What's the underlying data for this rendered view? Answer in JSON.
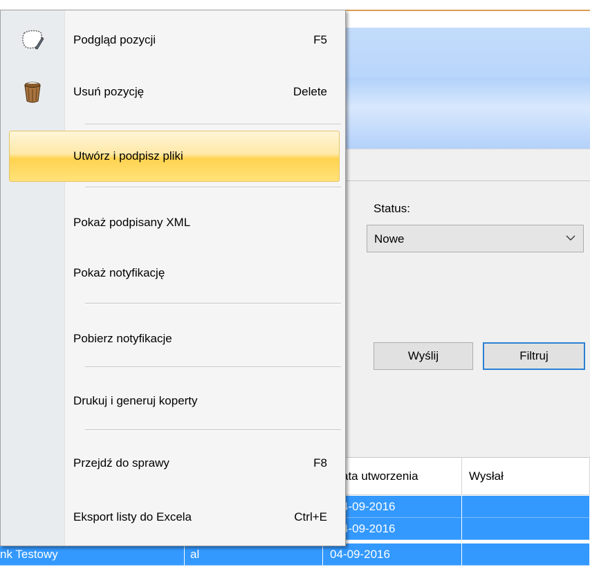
{
  "background": {
    "status_label": "Status:",
    "status_value": "Nowe",
    "send_button": "Wyślij",
    "filter_button": "Filtruj"
  },
  "grid": {
    "headers": [
      "ata utworzenia",
      "Wysłał"
    ],
    "rows": [
      {
        "c1": "",
        "c2": "",
        "date": "4-09-2016",
        "sender": ""
      },
      {
        "c1": "",
        "c2": "",
        "date": "4-09-2016",
        "sender": ""
      },
      {
        "c1": "nk Testowy",
        "c2": "al",
        "date": "04-09-2016",
        "sender": ""
      }
    ]
  },
  "menu": {
    "items": [
      {
        "label": "Podgląd pozycji",
        "shortcut": "F5",
        "icon": "preview-icon"
      },
      {
        "label": "Usuń pozycję",
        "shortcut": "Delete",
        "icon": "trash-bin-icon"
      },
      {
        "label": "Utwórz i podpisz pliki",
        "shortcut": ""
      },
      {
        "label": "Pokaż podpisany XML",
        "shortcut": ""
      },
      {
        "label": "Pokaż notyfikację",
        "shortcut": ""
      },
      {
        "label": "Pobierz notyfikacje",
        "shortcut": ""
      },
      {
        "label": "Drukuj i generuj koperty",
        "shortcut": ""
      },
      {
        "label": "Przejdź do sprawy",
        "shortcut": "F8"
      },
      {
        "label": "Eksport listy do Excela",
        "shortcut": "Ctrl+E"
      }
    ]
  },
  "colors": {
    "selection_blue": "#3399ff",
    "menu_highlight": "#ffd350",
    "ribbon_blue": "#b9d6fb"
  }
}
